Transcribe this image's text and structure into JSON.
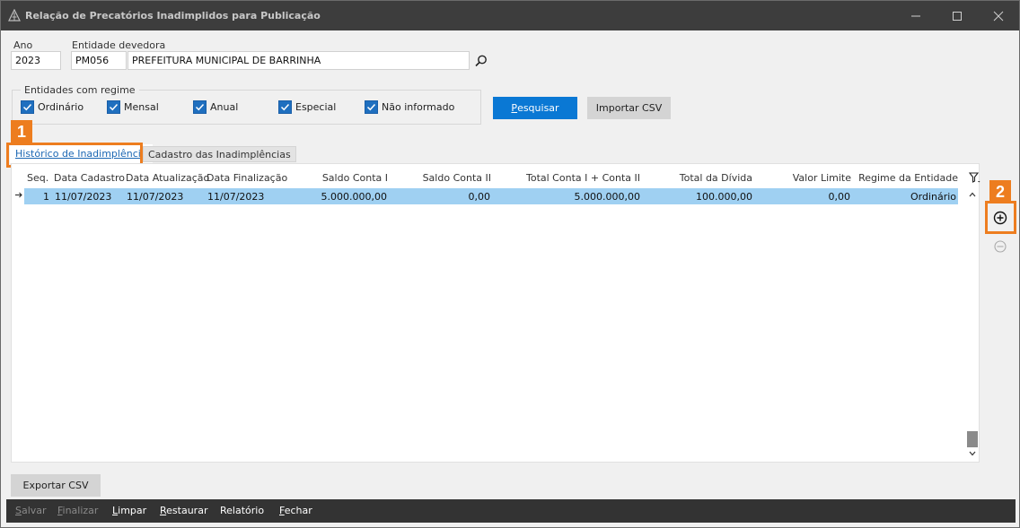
{
  "window": {
    "title": "Relação de Precatórios Inadimplidos para Publicação"
  },
  "filters": {
    "ano_label": "Ano",
    "ano_value": "2023",
    "entidade_label": "Entidade devedora",
    "entidade_code": "PM056",
    "entidade_name": "PREFEITURA MUNICIPAL DE BARRINHA"
  },
  "regime_group": {
    "label": "Entidades com regime",
    "options": [
      {
        "label": "Ordinário",
        "checked": true
      },
      {
        "label": "Mensal",
        "checked": true
      },
      {
        "label": "Anual",
        "checked": true
      },
      {
        "label": "Especial",
        "checked": true
      },
      {
        "label": "Não informado",
        "checked": true
      }
    ]
  },
  "actions": {
    "pesquisar_underlined": "P",
    "pesquisar_rest": "esquisar",
    "importar_csv": "Importar CSV"
  },
  "tabs": [
    {
      "label": "Histórico de Inadimplência",
      "active": true
    },
    {
      "label": "Cadastro das Inadimplências",
      "active": false
    }
  ],
  "callouts": {
    "badge1": "1",
    "badge2": "2"
  },
  "table": {
    "columns": [
      "Seq.",
      "Data Cadastro",
      "Data Atualização",
      "Data Finalização",
      "Saldo Conta I",
      "Saldo Conta II",
      "Total Conta I + Conta II",
      "Total da Dívida",
      "Valor Limite",
      "Regime da Entidade"
    ],
    "rows": [
      [
        "1",
        "11/07/2023",
        "11/07/2023",
        "11/07/2023",
        "5.000.000,00",
        "0,00",
        "5.000.000,00",
        "100.000,00",
        "0,00",
        "Ordinário"
      ]
    ]
  },
  "bottom": {
    "exportar_csv": "Exportar CSV"
  },
  "footer": [
    {
      "label": "Salvar",
      "u": "S",
      "rest": "alvar",
      "enabled": false
    },
    {
      "label": "Finalizar",
      "u": "F",
      "rest": "inalizar",
      "enabled": false
    },
    {
      "label": "Limpar",
      "u": "L",
      "rest": "impar",
      "enabled": true
    },
    {
      "label": "Restaurar",
      "u": "R",
      "rest": "estaurar",
      "enabled": true
    },
    {
      "label": "Relatório",
      "u": "",
      "rest": "Relatório",
      "enabled": true
    },
    {
      "label": "Fechar",
      "u": "F",
      "rest": "echar",
      "enabled": true
    }
  ],
  "colors": {
    "titlebar": "#3d3d3d",
    "accent": "#0a78d4",
    "selected_row": "#9fd0f2",
    "callout": "#ed7d1f",
    "footer": "#333333"
  }
}
